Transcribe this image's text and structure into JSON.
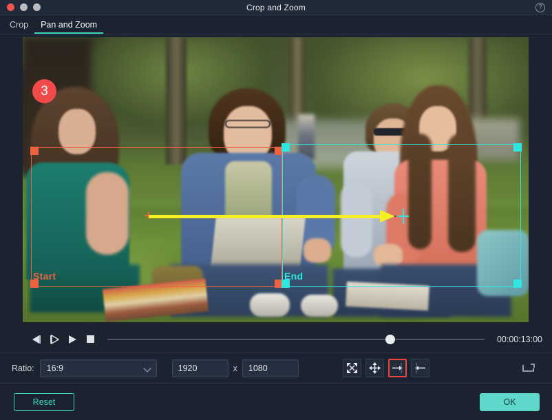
{
  "window": {
    "title": "Crop and Zoom",
    "help_icon": "question-circle-icon",
    "traffic_lights": [
      "close",
      "minimize",
      "maximize"
    ]
  },
  "tabs": [
    {
      "label": "Crop",
      "active": false
    },
    {
      "label": "Pan and Zoom",
      "active": true
    }
  ],
  "preview": {
    "step_badge": "3",
    "start_rect": {
      "label": "Start",
      "color": "#f0613f"
    },
    "end_rect": {
      "label": "End",
      "color": "#2fe6e0"
    },
    "motion_arrow_color": "#f5f024"
  },
  "transport": {
    "prev_frame": "previous-frame-icon",
    "next_frame": "next-frame-icon",
    "play": "play-icon",
    "stop": "stop-icon",
    "timecode": "00:00:13:00",
    "slider_position_percent": 68
  },
  "options": {
    "ratio_label": "Ratio:",
    "ratio_value": "16:9",
    "ratio_options": [
      "16:9"
    ],
    "width_value": "1920",
    "separator": "x",
    "height_value": "1080",
    "buttons": [
      {
        "name": "fit-to-frame",
        "icon": "collapse-arrows-icon",
        "selected": false
      },
      {
        "name": "pan-move",
        "icon": "move-arrows-icon",
        "selected": false
      },
      {
        "name": "zoom-in",
        "icon": "arrow-right-icon",
        "selected": true
      },
      {
        "name": "zoom-out",
        "icon": "arrow-left-icon",
        "selected": false
      }
    ],
    "crop_icon": "crop-icon"
  },
  "footer": {
    "reset_label": "Reset",
    "ok_label": "OK"
  },
  "colors": {
    "accent": "#3fd9ba",
    "ok_button": "#5ed8cb",
    "selection": "#f0453f",
    "start": "#f0613f",
    "end": "#2fe6e0",
    "arrow": "#f5f024",
    "badge": "#f04a4a"
  }
}
